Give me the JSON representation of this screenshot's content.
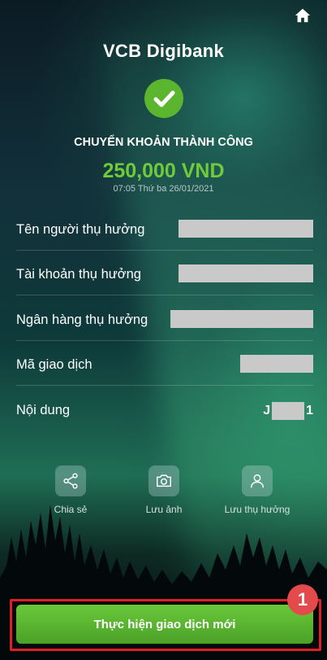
{
  "app": {
    "brand_strong": "VCB",
    "brand_rest": "Digibank"
  },
  "status": {
    "title": "CHUYỂN KHOẢN THÀNH CÔNG",
    "amount": "250,000 VND",
    "datetime": "07:05 Thứ ba 26/01/2021"
  },
  "details": {
    "beneficiary_name_label": "Tên người thụ hưởng",
    "beneficiary_account_label": "Tài khoản thụ hưởng",
    "beneficiary_bank_label": "Ngân hàng thụ hưởng",
    "transaction_code_label": "Mã giao dịch",
    "content_label": "Nội dung",
    "content_prefix": "J",
    "content_suffix": "1"
  },
  "actions": {
    "share_label": "Chia sẻ",
    "save_image_label": "Lưu ảnh",
    "save_beneficiary_label": "Lưu thụ hưởng"
  },
  "cta": {
    "label": "Thực hiện giao dịch mới",
    "step_number": "1"
  },
  "colors": {
    "success_green": "#5cb52e",
    "amount_green": "#6fcb3a",
    "highlight_red": "#e01e25",
    "badge_red": "#e24a4c"
  }
}
